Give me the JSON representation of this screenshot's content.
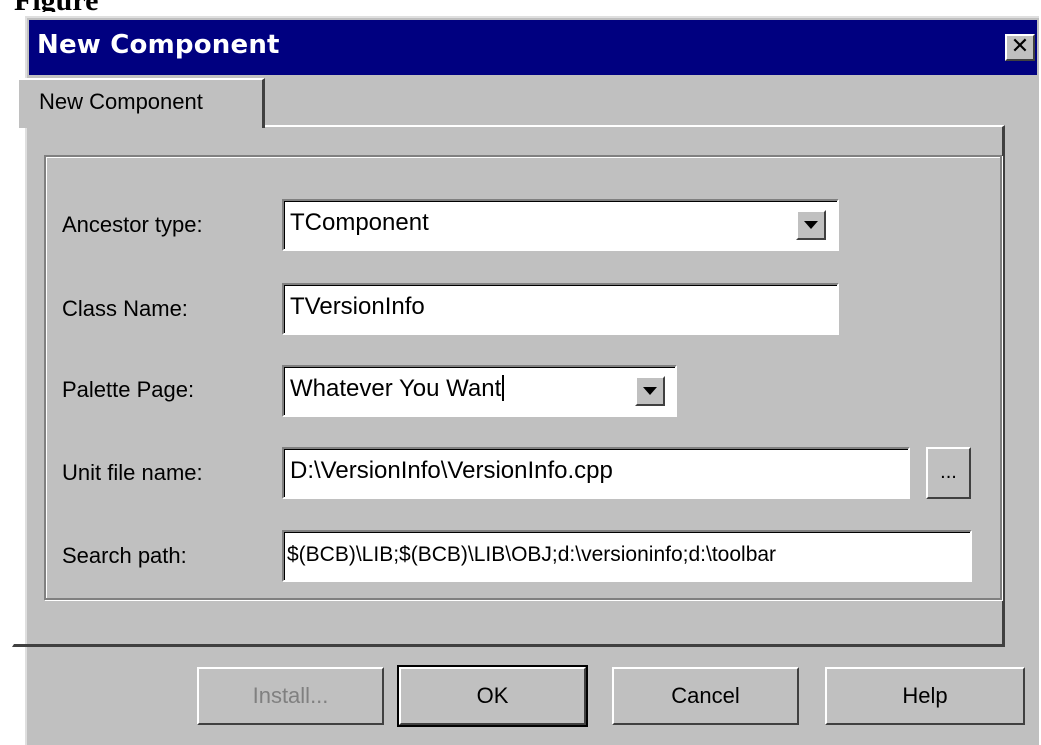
{
  "page_caption": "Figure",
  "window": {
    "title": "New Component",
    "close_glyph": "✕"
  },
  "tabs": [
    {
      "label": "New Component",
      "selected": true
    }
  ],
  "form": {
    "ancestor_type": {
      "label": "Ancestor type:",
      "value": "TComponent"
    },
    "class_name": {
      "label": "Class Name:",
      "value": "TVersionInfo"
    },
    "palette_page": {
      "label": "Palette Page:",
      "value": "Whatever You Want"
    },
    "unit_file_name": {
      "label": "Unit file name:",
      "value": "D:\\VersionInfo\\VersionInfo.cpp",
      "browse_label": "..."
    },
    "search_path": {
      "label": "Search path:",
      "value": "$(BCB)\\LIB;$(BCB)\\LIB\\OBJ;d:\\versioninfo;d:\\toolbar"
    }
  },
  "buttons": {
    "install": "Install...",
    "ok": "OK",
    "cancel": "Cancel",
    "help": "Help"
  },
  "colors": {
    "titlebar": "#000080",
    "face": "#c0c0c0"
  }
}
